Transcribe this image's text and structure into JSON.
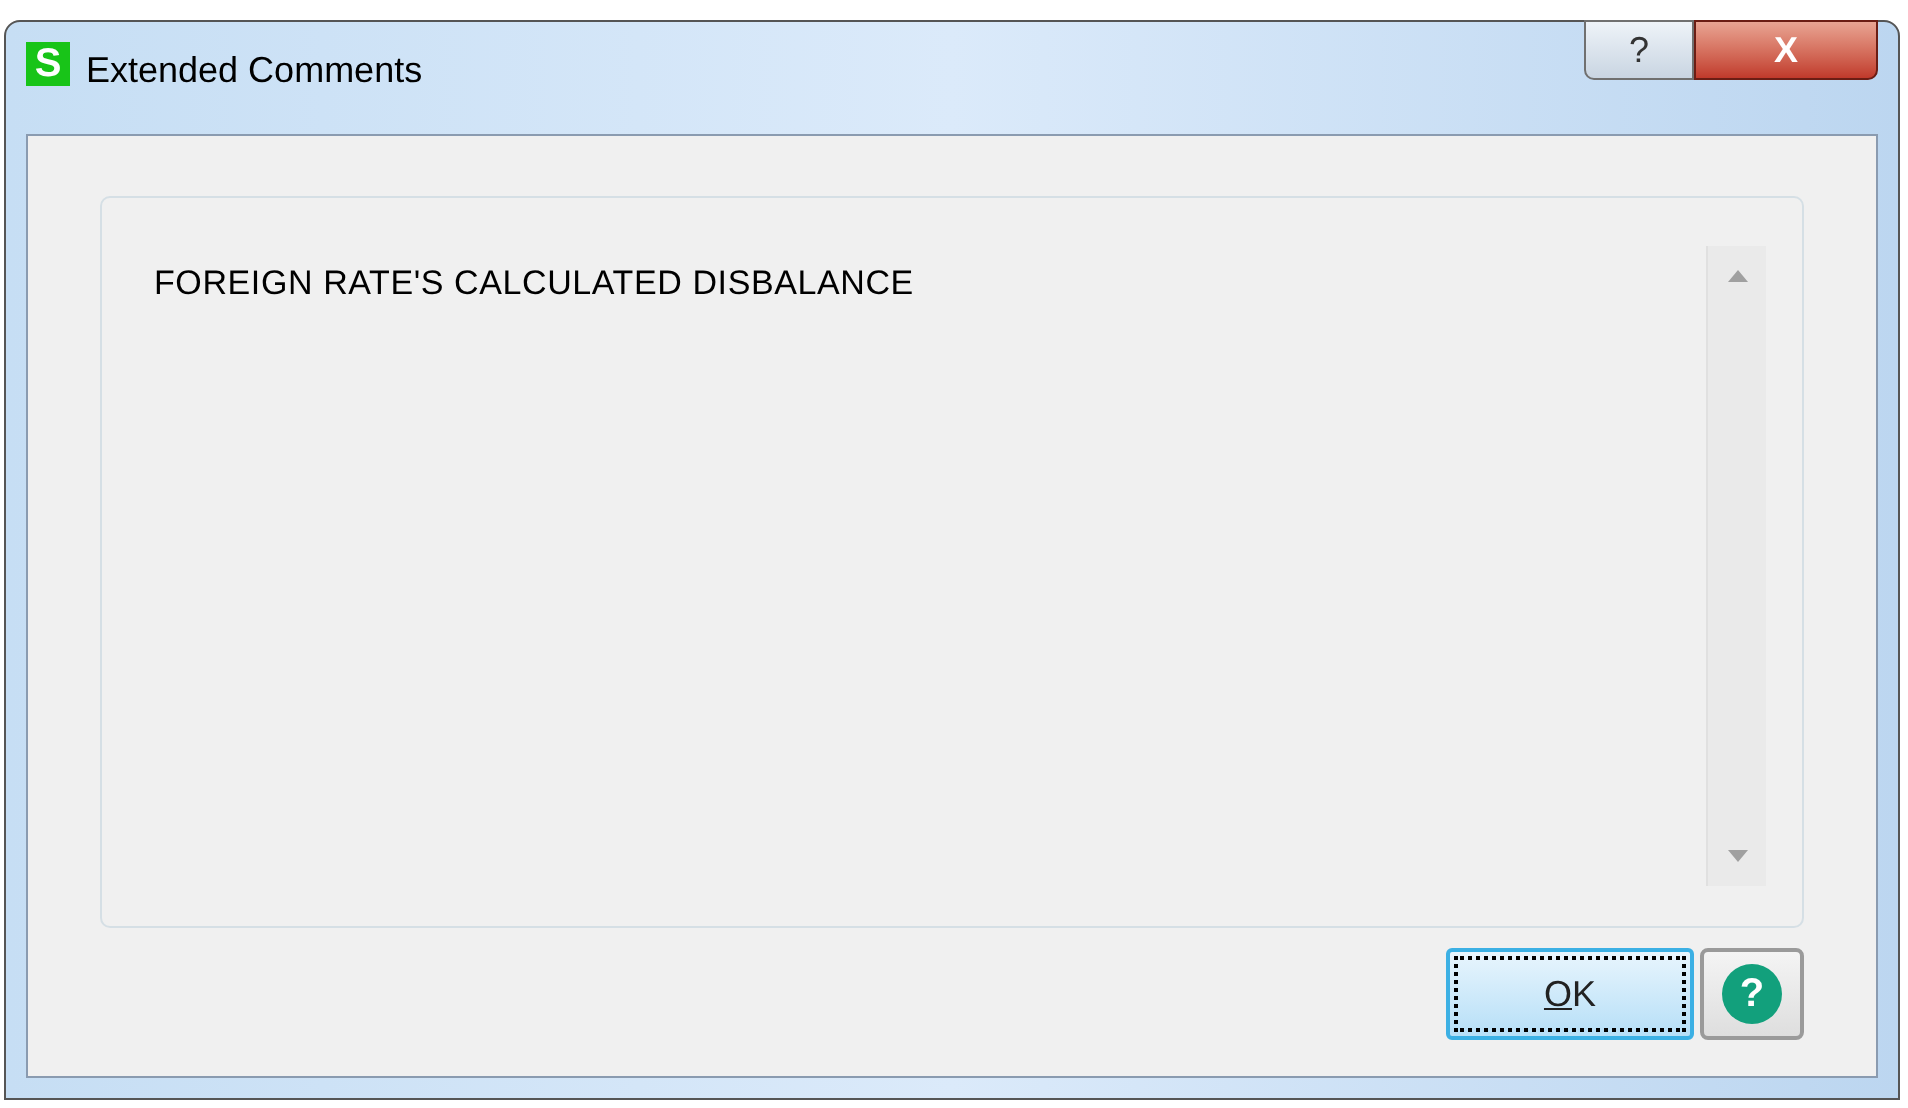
{
  "window": {
    "app_logo": "S",
    "title": "Extended Comments",
    "help_button": "?",
    "close_button": "X"
  },
  "comment": {
    "value": "FOREIGN RATE'S CALCULATED DISBALANCE"
  },
  "buttons": [
    {
      "kind": "ok",
      "label": "OK",
      "access_key_shown": true,
      "focused": true
    },
    {
      "kind": "help",
      "label": "?",
      "focused": false
    }
  ]
}
